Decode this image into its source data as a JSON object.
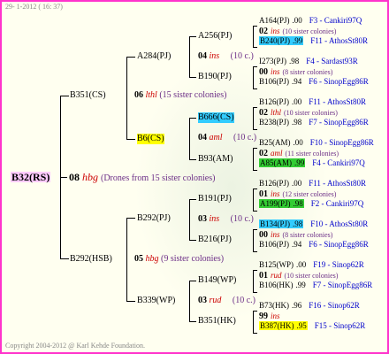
{
  "header": {
    "date": "29-  1-2012 ( 16: 37)"
  },
  "footer": {
    "copyright": "Copyright 2004-2012 @ Karl Kehde Foundation."
  },
  "colors": {
    "frame": "#ff33cc",
    "cyan": "#33ccff",
    "yellow": "#ffff00",
    "green": "#33cc33"
  },
  "root": {
    "label": "B32(RS)",
    "num": "08",
    "code": "hbg",
    "note": "(Drones from 15 sister colonies)"
  },
  "gen1": [
    {
      "label": "B351(CS)",
      "num": "06",
      "code": "lthl",
      "note": "(15 sister colonies)"
    },
    {
      "label": "B292(HSB)",
      "num": "05",
      "code": "hbg",
      "note": "(9 sister colonies)"
    }
  ],
  "gen2": [
    {
      "label": "A284(PJ)"
    },
    {
      "label": "B6(CS)"
    },
    {
      "label": "B292(PJ)"
    },
    {
      "label": "B339(WP)"
    }
  ],
  "gen3": [
    {
      "label": "A256(PJ)",
      "num": "04",
      "code": "ins",
      "note": "(10 c.)"
    },
    {
      "label": "B190(PJ)"
    },
    {
      "label": "B666(CS)",
      "num": "04",
      "code": "aml",
      "note": "(10 c.)"
    },
    {
      "label": "B93(AM)"
    },
    {
      "label": "B191(PJ)",
      "num": "03",
      "code": "ins",
      "note": "(10 c.)"
    },
    {
      "label": "B216(PJ)"
    },
    {
      "label": "B149(WP)",
      "num": "03",
      "code": "rud",
      "note": "(10 c.)"
    },
    {
      "label": "B351(HK)"
    }
  ],
  "leaves": [
    {
      "name": "A164(PJ)",
      "val": ".00",
      "ref": "F3 - Cankiri97Q"
    },
    {
      "num": "02",
      "code": "ins",
      "note": "(10 sister colonies)"
    },
    {
      "name": "B240(PJ)",
      "val": ".99",
      "ref": "F11 - AthosSt80R"
    },
    {
      "name": "I273(PJ)",
      "val": ".98",
      "ref": "F4 - Sardast93R"
    },
    {
      "num": "00",
      "code": "ins",
      "note": "(8 sister colonies)"
    },
    {
      "name": "B106(PJ)",
      "val": ".94",
      "ref": "F6 - SinopEgg86R"
    },
    {
      "name": "B126(PJ)",
      "val": ".00",
      "ref": "F11 - AthosSt80R"
    },
    {
      "num": "02",
      "code": "lthl",
      "note": "(10 sister colonies)"
    },
    {
      "name": "B238(PJ)",
      "val": ".98",
      "ref": "F7 - SinopEgg86R"
    },
    {
      "name": "B25(AM)",
      "val": ".00",
      "ref": "F10 - SinopEgg86R"
    },
    {
      "num": "02",
      "code": "aml",
      "note": "(11 sister colonies)"
    },
    {
      "name": "A85(AM)",
      "val": ".99",
      "ref": "F4 - Cankiri97Q"
    },
    {
      "name": "B126(PJ)",
      "val": ".00",
      "ref": "F11 - AthosSt80R"
    },
    {
      "num": "01",
      "code": "ins",
      "note": "(12 sister colonies)"
    },
    {
      "name": "A199(PJ)",
      "val": ".98",
      "ref": "F2 - Cankiri97Q"
    },
    {
      "name": "B134(PJ)",
      "val": ".98",
      "ref": "F10 - AthosSt80R"
    },
    {
      "num": "00",
      "code": "ins",
      "note": "(8 sister colonies)"
    },
    {
      "name": "B106(PJ)",
      "val": ".94",
      "ref": "F6 - SinopEgg86R"
    },
    {
      "name": "B125(WP)",
      "val": ".00",
      "ref": "F19 - Sinop62R"
    },
    {
      "num": "01",
      "code": "rud",
      "note": "(10 sister colonies)"
    },
    {
      "name": "B106(HK)",
      "val": ".99",
      "ref": "F7 - SinopEgg86R"
    },
    {
      "name": "B73(HK)",
      "val": ".96",
      "ref": "F16 - Sinop62R"
    },
    {
      "num": "99",
      "code": "ins",
      "note": ""
    },
    {
      "name": "B387(HK)",
      "val": ".95",
      "ref": "F15 - Sinop62R"
    }
  ]
}
